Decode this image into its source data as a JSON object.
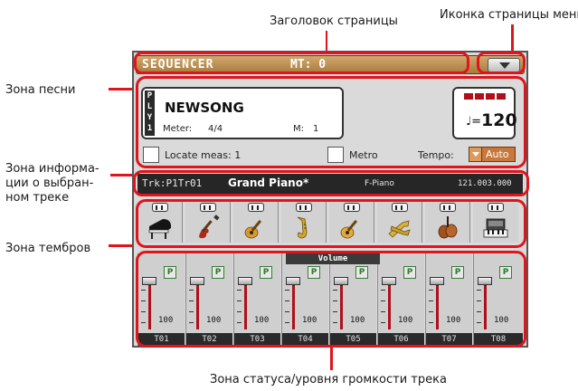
{
  "annotations": {
    "page_title": "Заголовок страницы",
    "menu_icon": "Иконка страницы меню",
    "song_area": "Зона песни",
    "track_info_area": [
      "Зона информа-",
      "ции о выбран-",
      "ном треке"
    ],
    "sounds_area": "Зона тембров",
    "mixer_area": "Зона статуса/уровня громкости трека"
  },
  "header": {
    "title": "SEQUENCER",
    "measure_time": "MT: 0",
    "menu_icon": "chevron-down-icon"
  },
  "song": {
    "player_tag": [
      "P",
      "L",
      "Y",
      "1"
    ],
    "name": "NEWSONG",
    "meter_label": "Meter:",
    "meter_value": "4/4",
    "measure_label": "M:",
    "measure_value": "1",
    "tempo_note": "♩=",
    "tempo_value": "120",
    "locate_label": "Locate meas: 1",
    "metro_label": "Metro",
    "tempo_label": "Tempo:",
    "tempo_mode": "Auto"
  },
  "track_info": {
    "track": "Trk:P1Tr01",
    "program": "Grand Piano*",
    "category": "F-Piano",
    "bank_number": "121.003.000"
  },
  "sounds": [
    {
      "icon": "grand-piano-icon"
    },
    {
      "icon": "electric-guitar-icon"
    },
    {
      "icon": "acoustic-guitar-icon"
    },
    {
      "icon": "saxophone-icon"
    },
    {
      "icon": "acoustic-guitar-icon"
    },
    {
      "icon": "brass-section-icon"
    },
    {
      "icon": "strings-section-icon"
    },
    {
      "icon": "synth-keyboard-icon"
    }
  ],
  "mixer": {
    "volume_tab": "Volume",
    "tracks": [
      {
        "name": "T01",
        "play_status": "P",
        "volume": "100"
      },
      {
        "name": "T02",
        "play_status": "P",
        "volume": "100"
      },
      {
        "name": "T03",
        "play_status": "P",
        "volume": "100"
      },
      {
        "name": "T04",
        "play_status": "P",
        "volume": "100"
      },
      {
        "name": "T05",
        "play_status": "P",
        "volume": "100"
      },
      {
        "name": "T06",
        "play_status": "P",
        "volume": "100"
      },
      {
        "name": "T07",
        "play_status": "P",
        "volume": "100"
      },
      {
        "name": "T08",
        "play_status": "P",
        "volume": "100"
      }
    ]
  },
  "colors": {
    "callout": "#e0141c",
    "title_bar": "#b98a4a",
    "tempo_select": "#c8783c",
    "fader_level": "#b0101a"
  }
}
